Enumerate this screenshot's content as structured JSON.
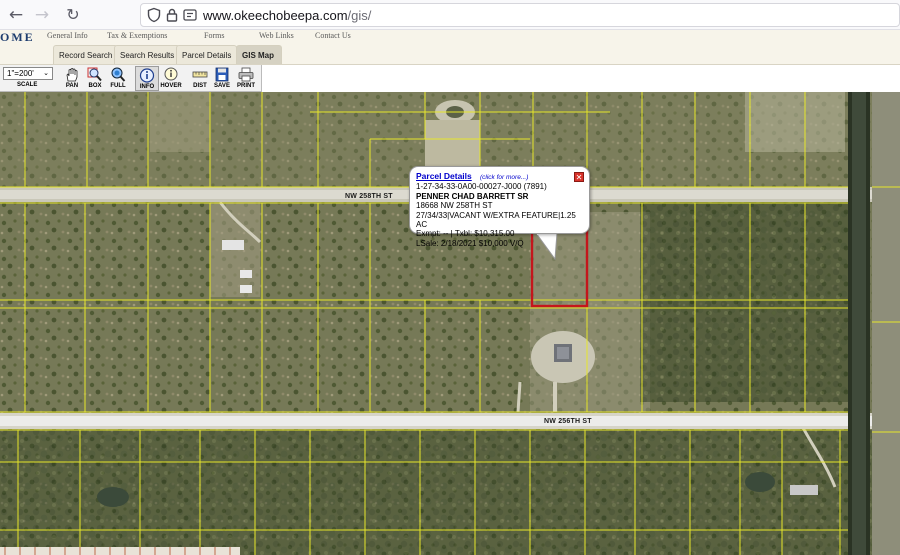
{
  "browser": {
    "url_domain": "www.okeechobeepa.com",
    "url_path": "/gis/"
  },
  "site": {
    "brand": "OME",
    "top_menu": [
      "General Info",
      "Tax & Exemptions",
      "Forms",
      "Web Links",
      "Contact Us"
    ],
    "sub_tabs": [
      "Record Search",
      "Search Results",
      "Parcel Details",
      "GIS Map"
    ],
    "active_tab": "GIS Map"
  },
  "toolbar": {
    "scale_value": "1\"=200'",
    "scale_label": "SCALE",
    "tools": [
      {
        "label": "PAN",
        "icon": "hand-icon"
      },
      {
        "label": "BOX",
        "icon": "zoom-box-icon"
      },
      {
        "label": "FULL",
        "icon": "zoom-full-icon"
      },
      {
        "label": "INFO",
        "icon": "info-icon"
      },
      {
        "label": "HOVER",
        "icon": "hover-icon"
      },
      {
        "label": "DIST",
        "icon": "ruler-icon"
      },
      {
        "label": "SAVE",
        "icon": "save-icon"
      },
      {
        "label": "PRINT",
        "icon": "printer-icon"
      }
    ],
    "active_tool": "INFO"
  },
  "map": {
    "road_labels": [
      "NW 258TH ST",
      "NW 256TH ST"
    ],
    "parcel_line_color": "#e6e62a",
    "selected_parcel_color": "#c4161c"
  },
  "popup": {
    "title": "Parcel Details",
    "more_link": "(click for more...)",
    "parcel_id": "1-27-34-33-0A00-00027-J000 (7891)",
    "owner": "PENNER CHAD BARRETT SR",
    "address": "18668 NW 258TH ST",
    "land_use": "27/34/33|VACANT W/EXTRA FEATURE|1.25 AC",
    "exempt": "Exmpt: -- | Txbl: $10,315.00",
    "last_sale": "LSale: 2/18/2021 $10,000 V/Q"
  }
}
